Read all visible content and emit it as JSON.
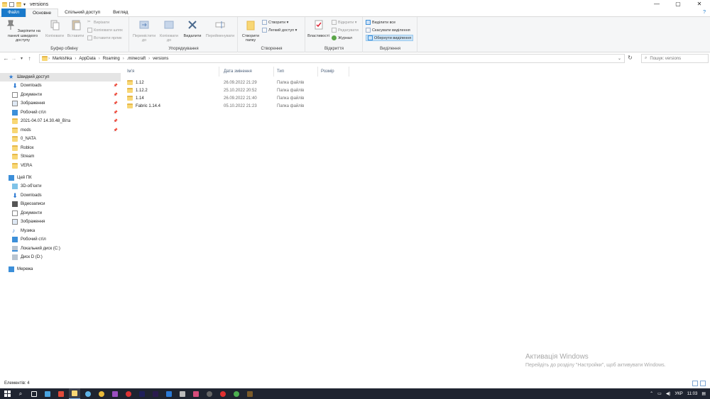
{
  "window": {
    "title": "versions",
    "controls": {
      "minimize": "—",
      "maximize": "▢",
      "close": "✕"
    }
  },
  "tabs": [
    {
      "label": "Файл"
    },
    {
      "label": "Основне"
    },
    {
      "label": "Спільний доступ"
    },
    {
      "label": "Вигляд"
    }
  ],
  "ribbon": {
    "clipboard": {
      "pin_label": "Закріпити на панелі швидкого доступу",
      "copy_label": "Копіювати",
      "paste_label": "Вставити",
      "cut_label": "Вирізати",
      "copy_path_label": "Копіювати шлях",
      "paste_shortcut_label": "Вставити ярлик",
      "group": "Буфер обміну"
    },
    "organize": {
      "move_label": "Перемістити до",
      "copy_to_label": "Копіювати до",
      "delete_label": "Видалити",
      "rename_label": "Перейменувати",
      "group": "Упорядкування"
    },
    "create": {
      "new_folder_label": "Створити папку",
      "new_item_label": "Створити ▾",
      "easy_access_label": "Легкий доступ ▾",
      "group": "Створення"
    },
    "open": {
      "properties_label": "Властивості",
      "open_label": "Відкрити ▾",
      "edit_label": "Редагувати",
      "history_label": "Журнал",
      "group": "Відкриття"
    },
    "select": {
      "select_all_label": "Виділити все",
      "select_none_label": "Скасувати виділення",
      "invert_label": "Обернути виділення",
      "group": "Виділення"
    }
  },
  "address": {
    "crumbs": [
      "Markishka",
      "AppData",
      "Roaming",
      ".minecraft",
      "versions"
    ],
    "search_placeholder": "Пошук: versions"
  },
  "nav": {
    "quick_access": "Швидкий доступ",
    "quick_items": [
      {
        "label": "Downloads",
        "pinned": true
      },
      {
        "label": "Документи",
        "pinned": true
      },
      {
        "label": "Зображення",
        "pinned": true
      },
      {
        "label": "Робочий стіл",
        "pinned": true
      },
      {
        "label": "2021-04.07 14.30.48_Віта",
        "pinned": true
      },
      {
        "label": "mods",
        "pinned": true
      },
      {
        "label": "0_NATA",
        "pinned": false
      },
      {
        "label": "Roblox",
        "pinned": false
      },
      {
        "label": "Stream",
        "pinned": false
      },
      {
        "label": "VERA",
        "pinned": false
      }
    ],
    "this_pc": "Цей ПК",
    "pc_items": [
      {
        "label": "3D-об'єкти"
      },
      {
        "label": "Downloads"
      },
      {
        "label": "Відеозаписи"
      },
      {
        "label": "Документи"
      },
      {
        "label": "Зображення"
      },
      {
        "label": "Музика"
      },
      {
        "label": "Робочий стіл"
      },
      {
        "label": "Локальний диск (C:)"
      },
      {
        "label": "Диск D (D:)"
      }
    ],
    "network": "Мережа"
  },
  "files": {
    "columns": [
      "Ім'я",
      "Дата змінення",
      "Тип",
      "Розмір"
    ],
    "rows": [
      {
        "name": "1.12",
        "date": "26.09.2022 21:29",
        "type": "Папка файлів"
      },
      {
        "name": "1.12.2",
        "date": "25.10.2022 20:52",
        "type": "Папка файлів"
      },
      {
        "name": "1.14",
        "date": "26.09.2022 21:40",
        "type": "Папка файлів"
      },
      {
        "name": "Fabric 1.14.4",
        "date": "05.10.2022 21:23",
        "type": "Папка файлів"
      }
    ]
  },
  "status": {
    "items_count": "Елементів: 4"
  },
  "watermark": {
    "line1": "Активація Windows",
    "line2": "Перейдіть до розділу \"Настройки\", щоб активувати Windows."
  },
  "taskbar": {
    "lang": "УКР",
    "time": "11:03"
  },
  "colors": {
    "accent": "#1979ca",
    "folder": "#f8d775",
    "taskbar": "#1f2430"
  }
}
